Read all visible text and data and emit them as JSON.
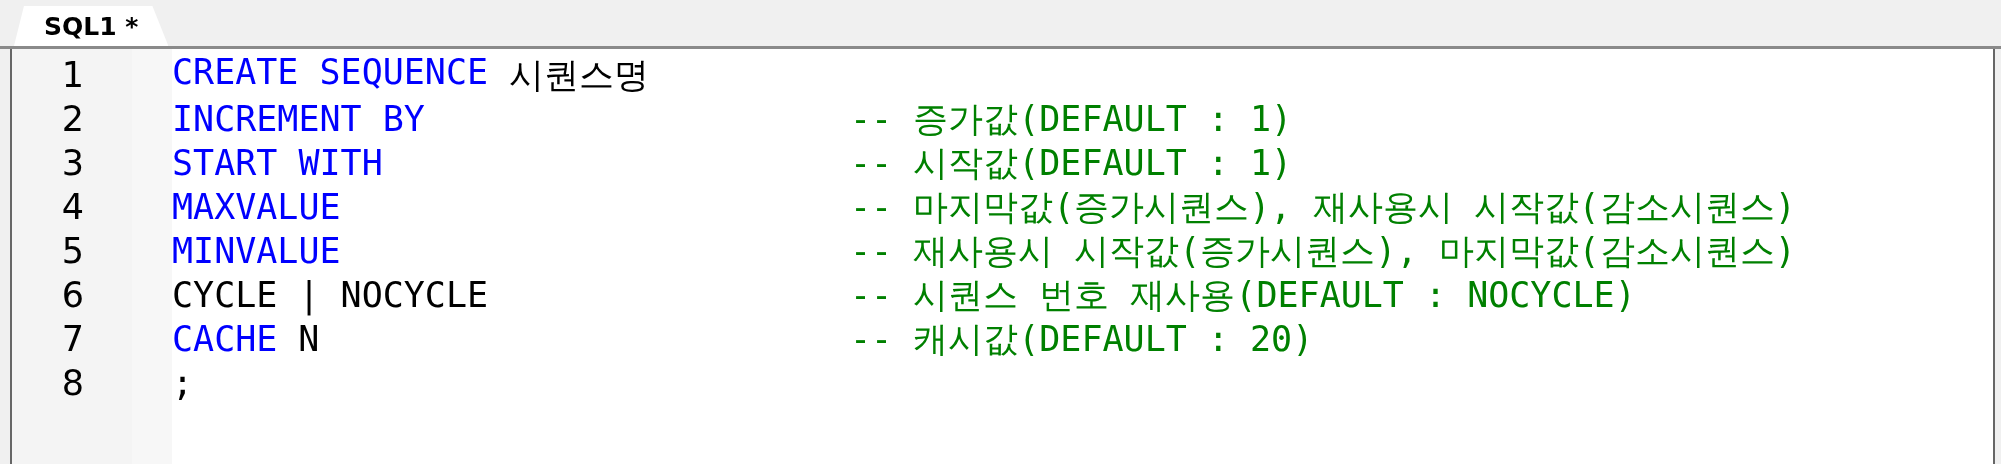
{
  "tabs": [
    {
      "label": "SQL1 *",
      "selected": true
    }
  ],
  "editor": {
    "lines": [
      {
        "number": "1",
        "code": [
          {
            "kind": "keyword",
            "text": "CREATE SEQUENCE"
          },
          {
            "kind": "plain",
            "text": "시퀀스명"
          }
        ]
      },
      {
        "number": "2",
        "code": [
          {
            "kind": "keyword",
            "text": "INCREMENT BY"
          }
        ],
        "comment": "-- 증가값(DEFAULT : 1)"
      },
      {
        "number": "3",
        "code": [
          {
            "kind": "keyword",
            "text": "START WITH"
          }
        ],
        "comment": "-- 시작값(DEFAULT : 1)"
      },
      {
        "number": "4",
        "code": [
          {
            "kind": "keyword",
            "text": "MAXVALUE"
          }
        ],
        "comment": "-- 마지막값(증가시퀀스), 재사용시 시작값(감소시퀀스)"
      },
      {
        "number": "5",
        "code": [
          {
            "kind": "keyword",
            "text": "MINVALUE"
          }
        ],
        "comment": "-- 재사용시 시작값(증가시퀀스), 마지막값(감소시퀀스)"
      },
      {
        "number": "6",
        "code": [
          {
            "kind": "plain",
            "text": "CYCLE | NOCYCLE"
          }
        ],
        "comment": "-- 시퀀스 번호 재사용(DEFAULT : NOCYCLE)"
      },
      {
        "number": "7",
        "code": [
          {
            "kind": "keyword",
            "text": "CACHE"
          },
          {
            "kind": "plain",
            "text": "N"
          }
        ],
        "comment": "-- 캐시값(DEFAULT : 20)"
      },
      {
        "number": "8",
        "code": [
          {
            "kind": "plain",
            "text": ";"
          }
        ]
      }
    ]
  }
}
